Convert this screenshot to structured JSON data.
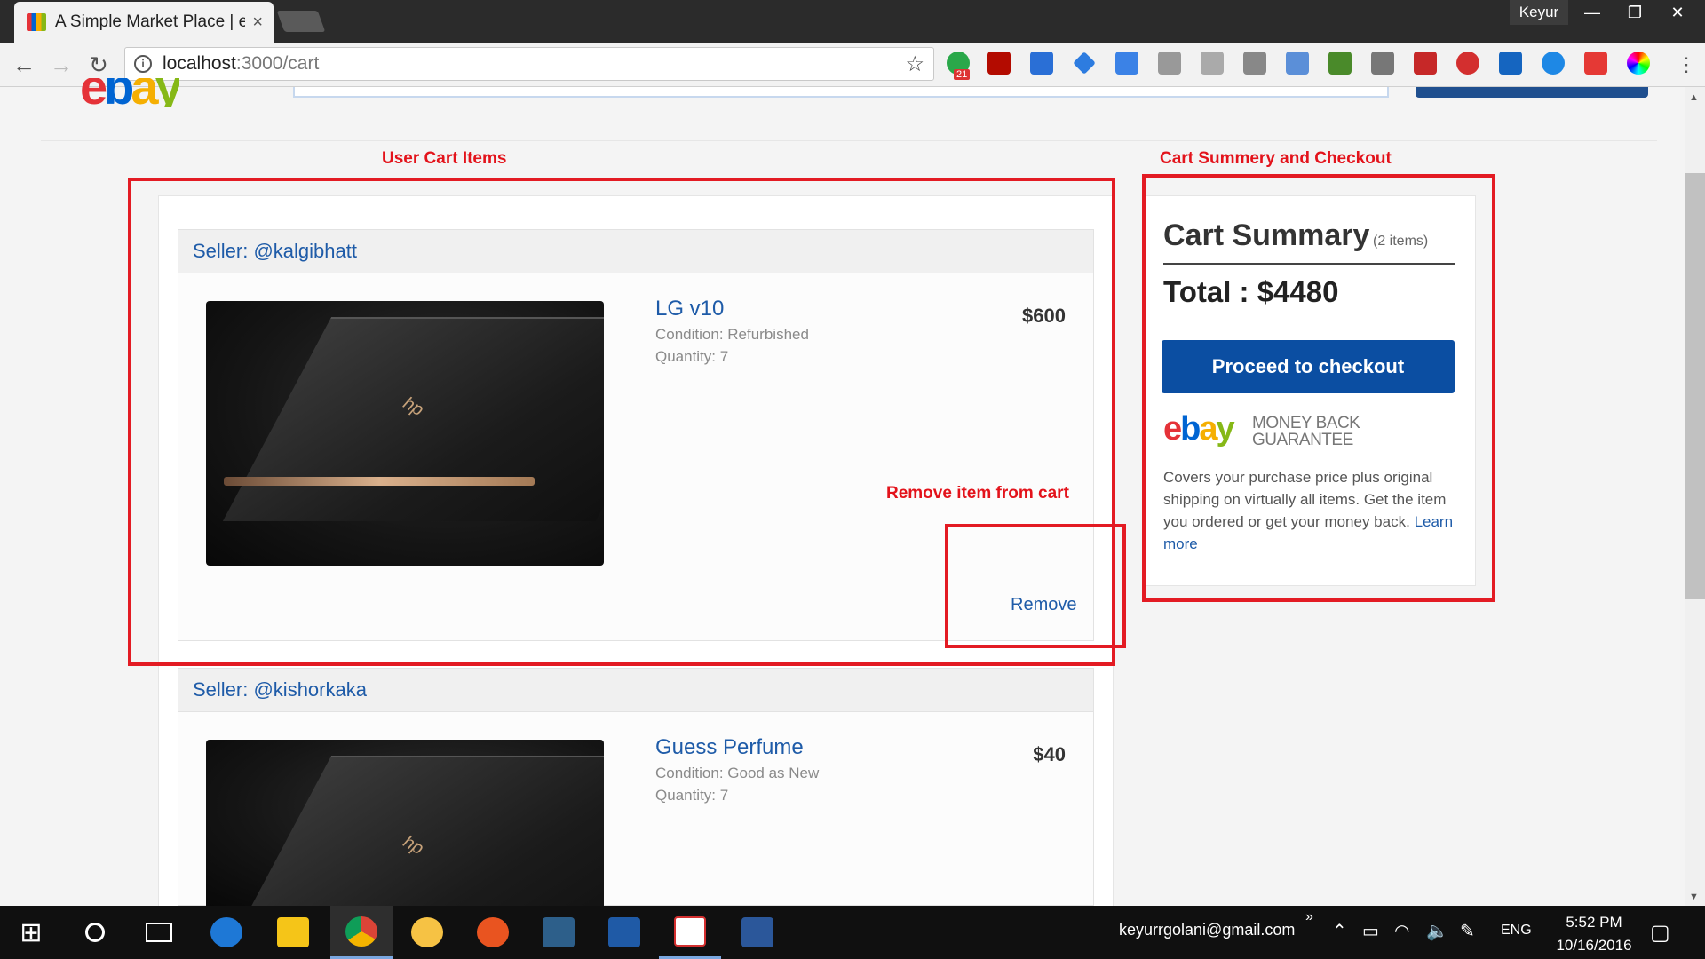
{
  "browser": {
    "tab_title": "A Simple Market Place | e",
    "tab_close": "×",
    "user": "Keyur",
    "minimize": "—",
    "restore": "❐",
    "close": "✕",
    "url_host": "localhost",
    "url_path": ":3000/cart",
    "extension_badge": "21"
  },
  "annotations": {
    "user_cart_items": "User Cart Items",
    "cart_summary_checkout": "Cart Summery and Checkout",
    "remove_item": "Remove item from cart"
  },
  "cart": {
    "groups": [
      {
        "seller": "Seller: @kalgibhatt",
        "item_name": "LG v10",
        "condition": "Condition: Refurbished",
        "quantity": "Quantity: 7",
        "price": "$600",
        "remove_label": "Remove"
      },
      {
        "seller": "Seller: @kishorkaka",
        "item_name": "Guess Perfume",
        "condition": "Condition: Good as New",
        "quantity": "Quantity: 7",
        "price": "$40"
      }
    ]
  },
  "summary": {
    "title": "Cart Summary",
    "count": "(2 items)",
    "total": "Total : $4480",
    "checkout_label": "Proceed to checkout",
    "logo": {
      "e": "e",
      "b": "b",
      "a": "a",
      "y": "y"
    },
    "mbg_line1": "MONEY BACK",
    "mbg_line2": "GUARANTEE",
    "covers_text": "Covers your purchase price plus original shipping on virtually all items. Get the item you ordered or get your money back.",
    "learn_more": "Learn more"
  },
  "taskbar": {
    "email": "keyurrgolani@gmail.com",
    "overflow": "»",
    "lang": "ENG",
    "time": "5:52 PM",
    "date": "10/16/2016"
  },
  "colors": {
    "accent_blue": "#0b4ea2",
    "link_blue": "#1e5ba8",
    "annotation_red": "#e3131b"
  }
}
